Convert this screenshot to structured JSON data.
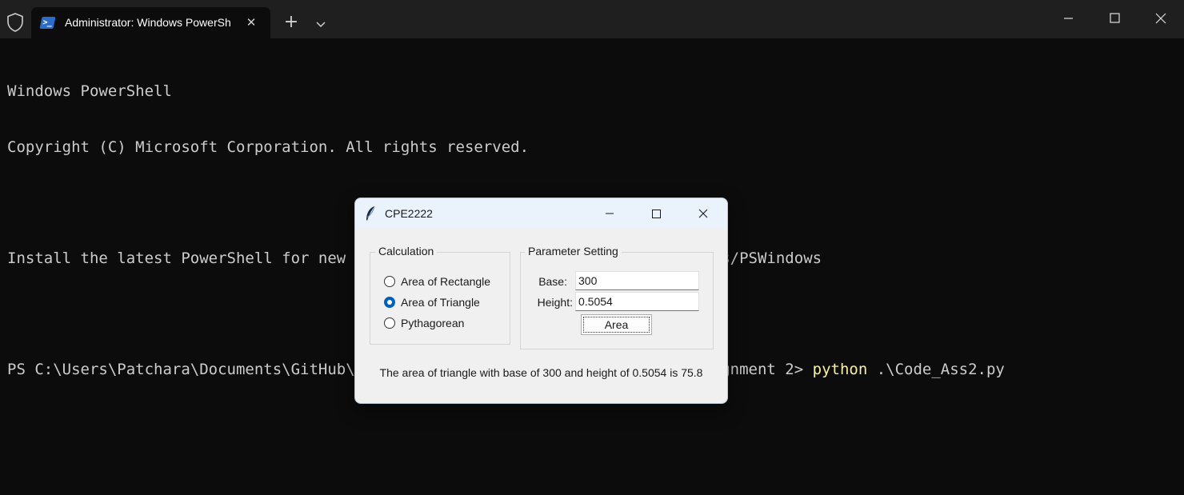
{
  "terminal": {
    "tab_title": "Administrator: Windows PowerShell",
    "lines": [
      "Windows PowerShell",
      "Copyright (C) Microsoft Corporation. All rights reserved.",
      "",
      "Install the latest PowerShell for new features and improvements! https://aka.ms/PSWindows",
      ""
    ],
    "prompt": "PS C:\\Users\\Patchara\\Documents\\GitHub\\CPE2222-Assignment\\Assingment-part2\\Assignment 2> ",
    "command": "python",
    "command_args": " .\\Code_Ass2.py",
    "icons": {
      "shield": "shield-icon",
      "tab": "powershell-icon",
      "new_tab": "+",
      "dropdown": "chevron-down-icon"
    }
  },
  "dialog": {
    "title": "CPE2222",
    "calculation": {
      "label": "Calculation",
      "options": [
        {
          "label": "Area of Rectangle",
          "checked": false
        },
        {
          "label": "Area of Triangle",
          "checked": true
        },
        {
          "label": "Pythagorean",
          "checked": false
        }
      ]
    },
    "parameters": {
      "label": "Parameter Setting",
      "base_label": "Base:",
      "base_value": "300",
      "height_label": "Height:",
      "height_value": "0.5054",
      "button_label": "Area"
    },
    "result": "The area of triangle with base of 300 and height of 0.5054 is 75.8"
  },
  "colors": {
    "terminal_bg": "#0c0c0c",
    "titlebar_bg": "#1f1f1f",
    "command": "#f9f1a5",
    "radio_accent": "#005fb8"
  }
}
